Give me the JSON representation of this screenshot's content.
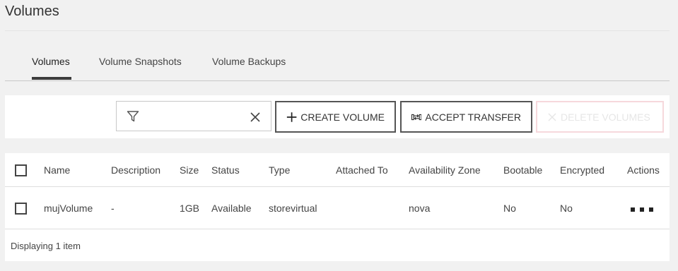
{
  "page": {
    "title": "Volumes"
  },
  "tabs": [
    {
      "label": "Volumes",
      "active": true
    },
    {
      "label": "Volume Snapshots",
      "active": false
    },
    {
      "label": "Volume Backups",
      "active": false
    }
  ],
  "toolbar": {
    "filter_value": "",
    "create_label": "CREATE VOLUME",
    "accept_label": "ACCEPT TRANSFER",
    "delete_label": "DELETE VOLUMES"
  },
  "table": {
    "columns": [
      "Name",
      "Description",
      "Size",
      "Status",
      "Type",
      "Attached To",
      "Availability Zone",
      "Bootable",
      "Encrypted",
      "Actions"
    ],
    "rows": [
      {
        "name": "mujVolume",
        "description": "-",
        "size": "1GB",
        "status": "Available",
        "type": "storevirtual",
        "attached_to": "",
        "availability_zone": "nova",
        "bootable": "No",
        "encrypted": "No"
      }
    ],
    "footer": "Displaying 1 item"
  },
  "colors": {
    "link": "#1a8a5a",
    "delete_border": "#f6d8dc",
    "tab_underline": "#3c3c3c"
  },
  "icons": {
    "filter": "filter-icon",
    "clear": "close-icon",
    "create": "plus-icon",
    "accept": "transfer-icon",
    "delete": "close-icon",
    "actions": "more-icon"
  }
}
